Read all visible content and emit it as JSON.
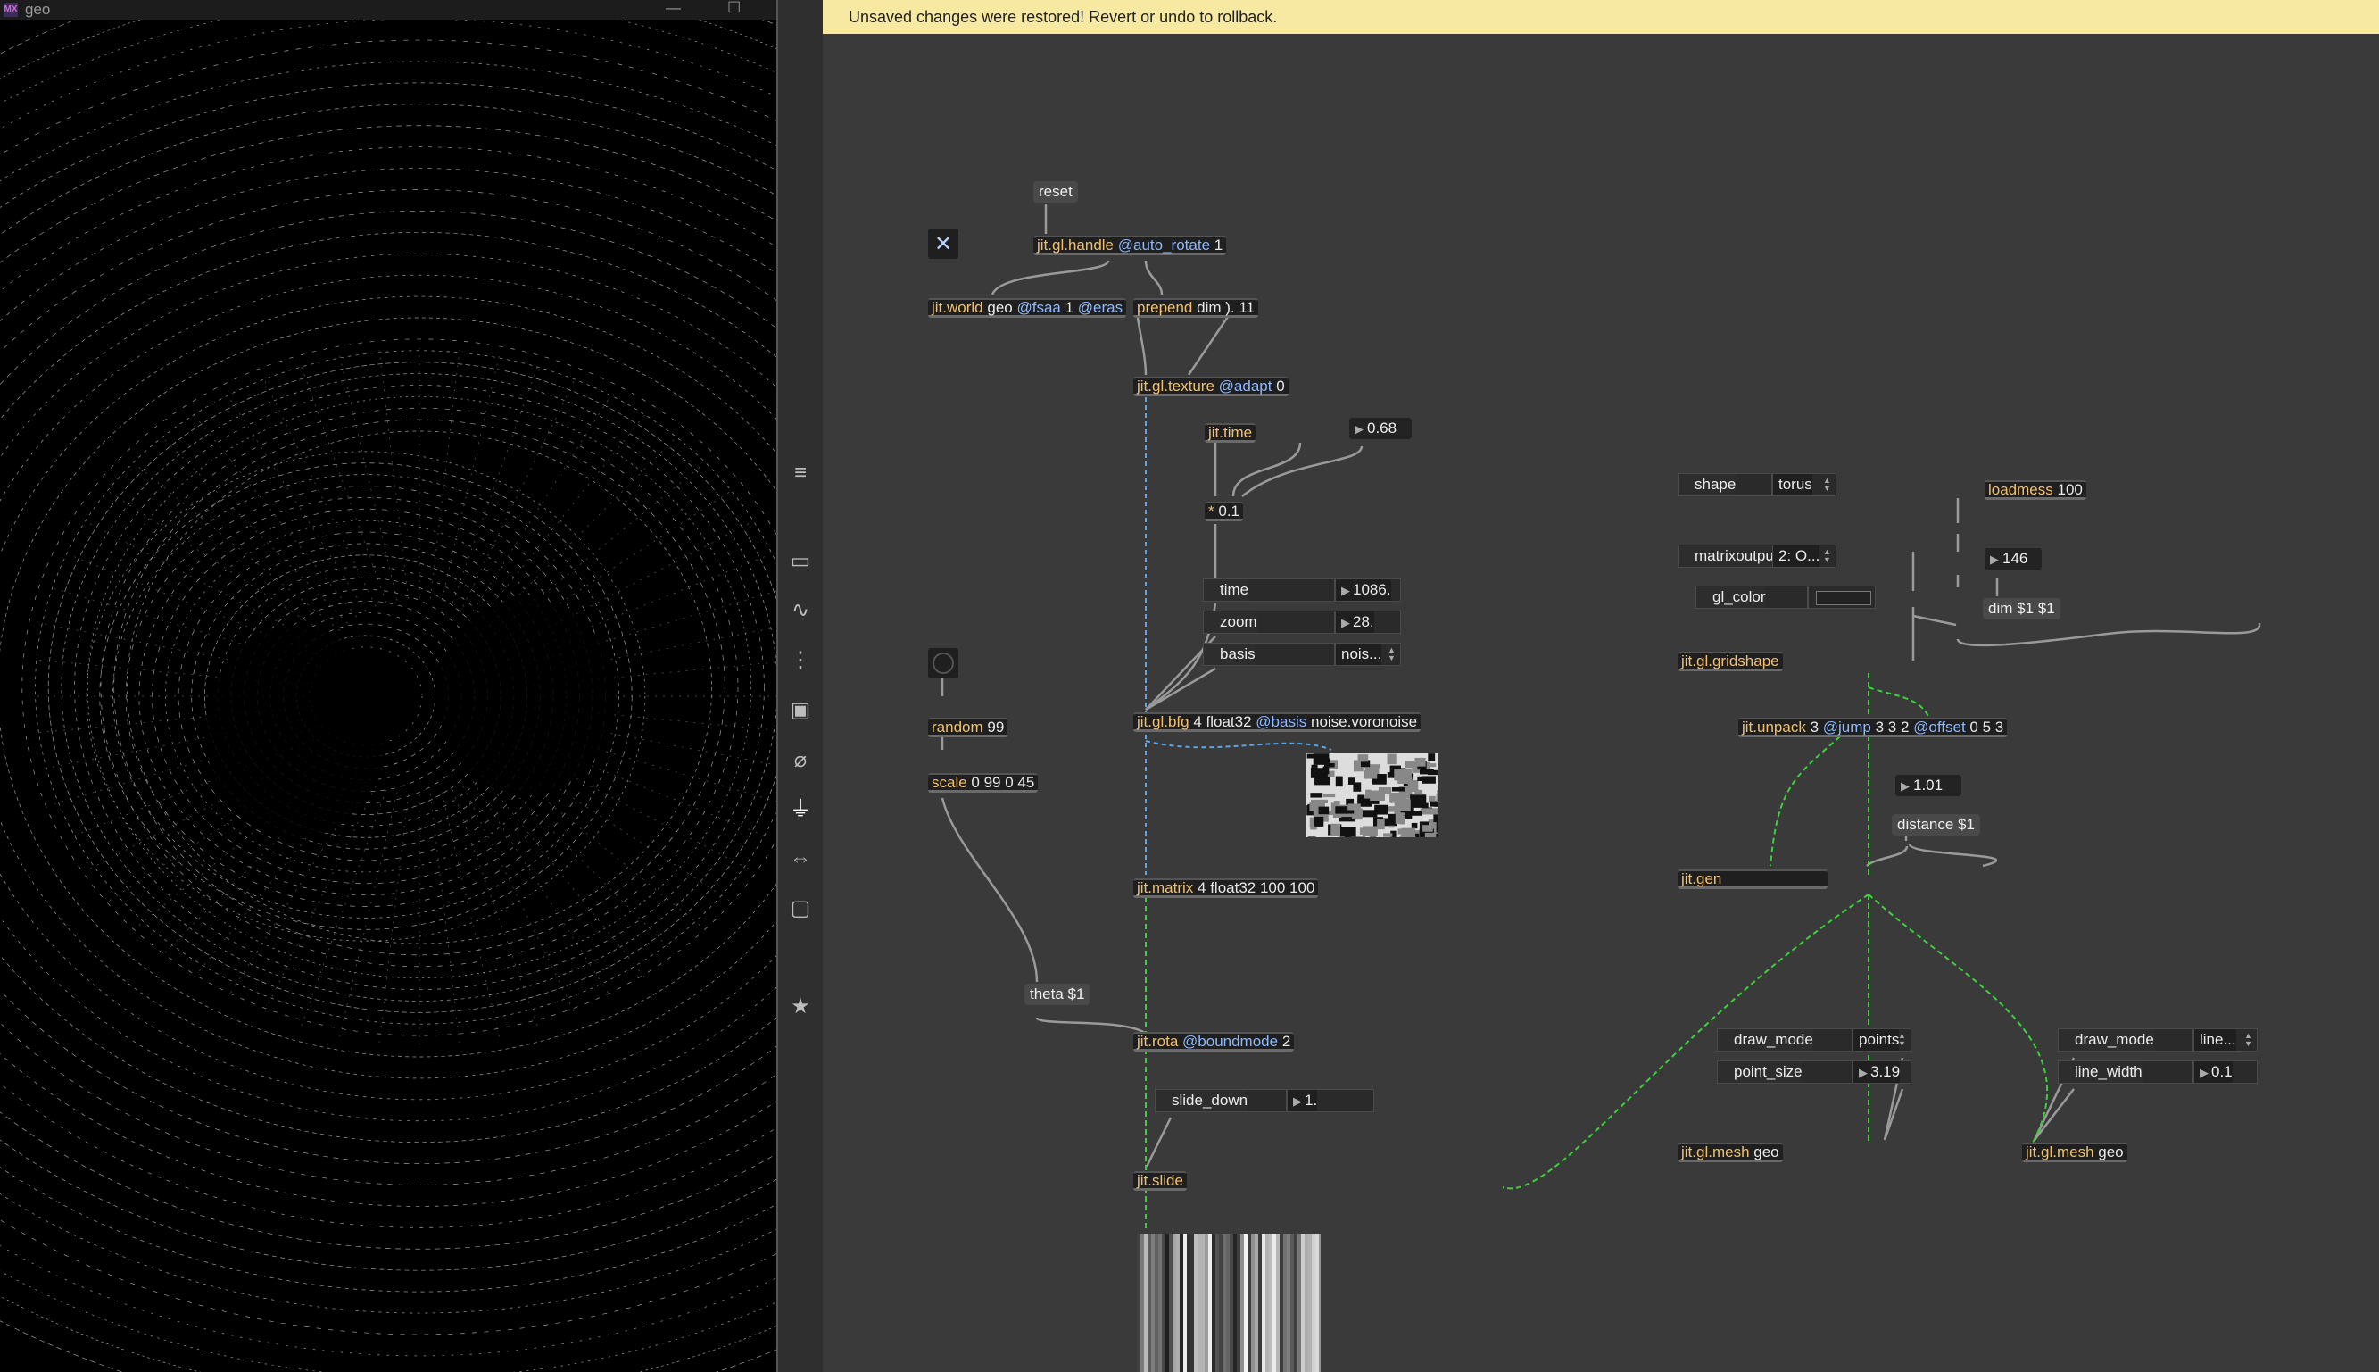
{
  "render_window": {
    "title": "geo",
    "app_badge": "MX",
    "minimize_glyph": "—",
    "maximize_glyph": "☐"
  },
  "toolbar": {
    "icons": [
      "menu-icon",
      "display-icon",
      "audio-icon",
      "midi-icon",
      "image-icon",
      "clip-icon",
      "plug-icon",
      "package-icon",
      "snapshot-icon",
      "star-icon"
    ]
  },
  "banner": {
    "text": "Unsaved changes were restored! Revert or undo to rollback."
  },
  "toggle_glyph": "✕",
  "objects": {
    "reset": "reset",
    "handle": {
      "name": "jit.gl.handle",
      "attr": "@auto_rotate",
      "args": "1"
    },
    "world": {
      "name": "jit.world",
      "args": "geo",
      "attr1": "@fsaa",
      "arg1": "1",
      "attr2": "@eras"
    },
    "prepend": {
      "name": "prepend",
      "args": "dim ). 11"
    },
    "texture": {
      "name": "jit.gl.texture",
      "attr": "@adapt",
      "args": "0"
    },
    "time": {
      "name": "jit.time"
    },
    "num_068": "0.68",
    "mult": {
      "name": "*",
      "args": "0.1"
    },
    "bfg_time": {
      "label": "time",
      "value": "1086."
    },
    "bfg_zoom": {
      "label": "zoom",
      "value": "28."
    },
    "bfg_basis": {
      "label": "basis",
      "value": "nois..."
    },
    "bfg": {
      "name": "jit.gl.bfg",
      "args": "4 float32",
      "attr": "@basis",
      "args2": "noise.voronoise"
    },
    "random": {
      "name": "random",
      "args": "99"
    },
    "scale": {
      "name": "scale",
      "args": "0 99 0 45"
    },
    "matrix": {
      "name": "jit.matrix",
      "args": "4 float32 100 100"
    },
    "theta": "theta $1",
    "rota": {
      "name": "jit.rota",
      "attr": "@boundmode",
      "args": "2"
    },
    "slide_down": {
      "label": "slide_down",
      "value": "1."
    },
    "slide": {
      "name": "jit.slide"
    },
    "shape": {
      "label": "shape",
      "value": "torus"
    },
    "loadmess": {
      "name": "loadmess",
      "args": "100"
    },
    "matrixoutput": {
      "label": "matrixoutput",
      "value": "2: O..."
    },
    "num_146": "146",
    "gl_color": {
      "label": "gl_color"
    },
    "dim_msg": "dim $1 $1",
    "gridshape": {
      "name": "jit.gl.gridshape"
    },
    "unpack": {
      "name": "jit.unpack",
      "args": "3",
      "attr1": "@jump",
      "arg1": "3 3 2",
      "attr2": "@offset",
      "arg2": "0 5 3"
    },
    "num_101": "1.01",
    "distance": "distance $1",
    "gen": {
      "name": "jit.gen"
    },
    "draw_mode_1": {
      "label": "draw_mode",
      "value": "points"
    },
    "point_size": {
      "label": "point_size",
      "value": "3.19"
    },
    "draw_mode_2": {
      "label": "draw_mode",
      "value": "line..."
    },
    "line_width": {
      "label": "line_width",
      "value": "0.1"
    },
    "mesh1": {
      "name": "jit.gl.mesh",
      "args": "geo"
    },
    "mesh2": {
      "name": "jit.gl.mesh",
      "args": "geo"
    }
  },
  "colors": {
    "patcher_bg": "#3a3a3a",
    "banner_bg": "#f7e8a2",
    "object_name": "#f0c070",
    "attribute": "#8cb8ff",
    "matrix_cable": "#3bd13b",
    "texture_cable": "#5aa6e8"
  }
}
